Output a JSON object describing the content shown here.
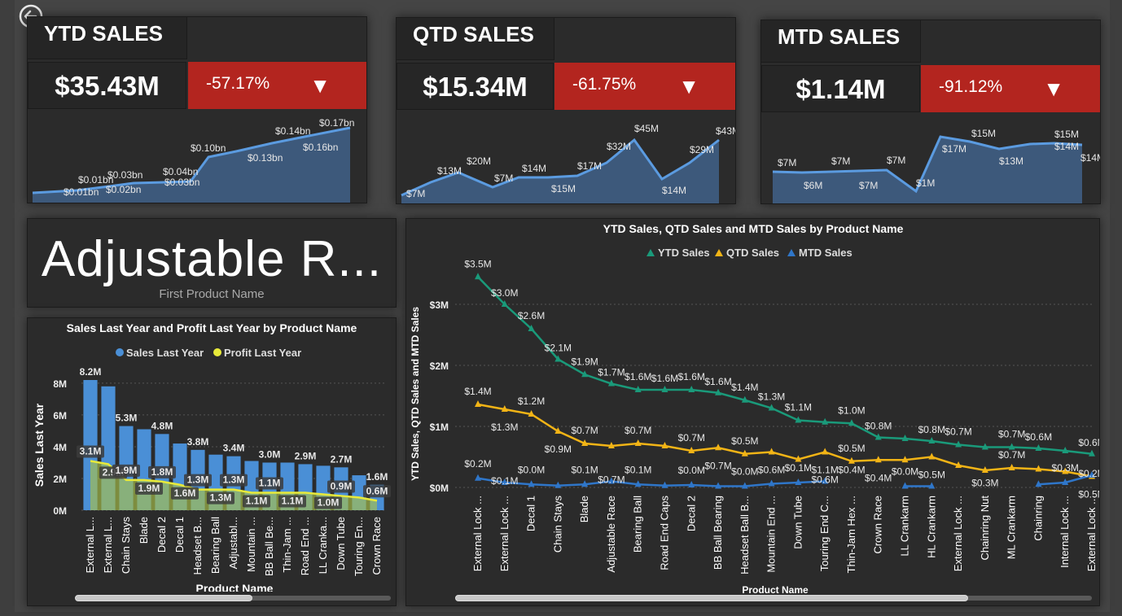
{
  "kpis": [
    {
      "title": "YTD SALES",
      "value": "$35.43M",
      "delta": "-57.17%",
      "arrow": "▼",
      "labels": [
        {
          "t": "$0.01bn",
          "x": 44,
          "y": 103
        },
        {
          "t": "$0.01bn",
          "x": 62,
          "y": 88
        },
        {
          "t": "$0.02bn",
          "x": 96,
          "y": 100
        },
        {
          "t": "$0.03bn",
          "x": 98,
          "y": 82
        },
        {
          "t": "$0.03bn",
          "x": 168,
          "y": 91
        },
        {
          "t": "$0.04bn",
          "x": 166,
          "y": 78
        },
        {
          "t": "$0.10bn",
          "x": 200,
          "y": 49
        },
        {
          "t": "$0.13bn",
          "x": 270,
          "y": 61
        },
        {
          "t": "$0.14bn",
          "x": 304,
          "y": 28
        },
        {
          "t": "$0.16bn",
          "x": 338,
          "y": 48
        },
        {
          "t": "$0.17bn",
          "x": 358,
          "y": 18
        }
      ]
    },
    {
      "title": "QTD SALES",
      "value": "$15.34M",
      "delta": "-61.75%",
      "arrow": "▼",
      "labels": [
        {
          "t": "$7M",
          "x": 12,
          "y": 104
        },
        {
          "t": "$13M",
          "x": 50,
          "y": 76
        },
        {
          "t": "$20M",
          "x": 86,
          "y": 64
        },
        {
          "t": "$7M",
          "x": 120,
          "y": 85
        },
        {
          "t": "$14M",
          "x": 154,
          "y": 73
        },
        {
          "t": "$15M",
          "x": 190,
          "y": 98
        },
        {
          "t": "$17M",
          "x": 222,
          "y": 70
        },
        {
          "t": "$32M",
          "x": 258,
          "y": 46
        },
        {
          "t": "$45M",
          "x": 292,
          "y": 24
        },
        {
          "t": "$14M",
          "x": 326,
          "y": 100
        },
        {
          "t": "$29M",
          "x": 360,
          "y": 50
        },
        {
          "t": "$43M",
          "x": 392,
          "y": 27
        }
      ]
    },
    {
      "title": "MTD SALES",
      "value": "$1.14M",
      "delta": "-91.12%",
      "arrow": "▼",
      "labels": [
        {
          "t": "$7M",
          "x": 20,
          "y": 63
        },
        {
          "t": "$6M",
          "x": 52,
          "y": 91
        },
        {
          "t": "$7M",
          "x": 86,
          "y": 61
        },
        {
          "t": "$7M",
          "x": 120,
          "y": 91
        },
        {
          "t": "$7M",
          "x": 154,
          "y": 60
        },
        {
          "t": "$1M",
          "x": 190,
          "y": 88
        },
        {
          "t": "$17M",
          "x": 222,
          "y": 46
        },
        {
          "t": "$15M",
          "x": 258,
          "y": 27
        },
        {
          "t": "$13M",
          "x": 292,
          "y": 61
        },
        {
          "t": "$15M",
          "x": 360,
          "y": 28
        },
        {
          "t": "$14M",
          "x": 360,
          "y": 43
        },
        {
          "t": "$14M",
          "x": 392,
          "y": 57
        }
      ]
    }
  ],
  "product_card": {
    "name": "Adjustable R...",
    "sub": "First Product Name"
  },
  "chart_data": [
    {
      "type": "bar",
      "title": "Sales Last Year and Profit Last Year by Product Name",
      "xlabel": "Product Name",
      "ylabel": "Sales Last Year",
      "ylim": [
        0,
        8200000
      ],
      "yticks": [
        "0M",
        "2M",
        "4M",
        "6M",
        "8M"
      ],
      "legend": [
        "Sales Last Year",
        "Profit Last Year"
      ],
      "colors": {
        "sales": "#4a8fd6",
        "profit": "#e8ea3a"
      },
      "categories": [
        "External L...",
        "External L...",
        "Chain Stays",
        "Blade",
        "Decal 2",
        "Decal 1",
        "Headset B...",
        "Bearing Ball",
        "Adjustabl...",
        "Mountain ...",
        "BB Ball Be...",
        "Thin-Jam ...",
        "Road End ...",
        "LL Cranka...",
        "Down Tube",
        "Touring En...",
        "Crown Race"
      ],
      "series": [
        {
          "name": "Sales Last Year",
          "values": [
            8.2,
            7.8,
            5.3,
            5.1,
            4.8,
            4.2,
            3.8,
            3.5,
            3.4,
            3.1,
            3.0,
            3.0,
            2.9,
            2.8,
            2.7,
            2.2,
            1.6
          ],
          "labels": [
            "8.2M",
            "",
            "5.3M",
            "",
            "4.8M",
            "",
            "3.8M",
            "",
            "3.4M",
            "",
            "3.0M",
            "",
            "2.9M",
            "",
            "2.7M",
            "",
            "1.6M"
          ]
        },
        {
          "name": "Profit Last Year",
          "values": [
            3.1,
            2.9,
            1.9,
            1.9,
            1.8,
            1.6,
            1.3,
            1.3,
            1.3,
            1.1,
            1.1,
            1.1,
            1.1,
            1.0,
            0.9,
            0.8,
            0.6
          ],
          "labels": [
            "3.1M",
            "2.9M",
            "1.9M",
            "1.9M",
            "1.8M",
            "1.6M",
            "1.3M",
            "1.3M",
            "1.3M",
            "1.1M",
            "1.1M",
            "1.1M",
            "",
            "1.0M",
            "0.9M",
            "",
            "0.6M"
          ]
        }
      ]
    },
    {
      "type": "line",
      "title": "YTD Sales, QTD Sales and MTD Sales by Product Name",
      "xlabel": "Product Name",
      "ylabel": "YTD Sales, QTD Sales and MTD Sales",
      "ylim": [
        0,
        3.5
      ],
      "yticks": [
        "$0M",
        "$1M",
        "$2M",
        "$3M"
      ],
      "legend": [
        "YTD Sales",
        "QTD Sales",
        "MTD Sales"
      ],
      "colors": {
        "ytd": "#1a9a7a",
        "qtd": "#f2b416",
        "mtd": "#2f76c9"
      },
      "categories": [
        "External Lock ...",
        "External Lock ...",
        "Decal 1",
        "Chain Stays",
        "Blade",
        "Adjustable Race",
        "Bearing Ball",
        "Road End Caps",
        "Decal 2",
        "BB Ball Bearing",
        "Headset Ball B...",
        "Mountain End ...",
        "Down Tube",
        "Touring End C...",
        "Thin-Jam Hex ...",
        "Crown Race",
        "LL Crankarm",
        "HL Crankarm",
        "External Lock ...",
        "Chainring Nut",
        "ML Crankarm",
        "Chainring",
        "Internal Lock ...",
        "External Lock ..."
      ],
      "series": [
        {
          "name": "YTD Sales",
          "values": [
            3.45,
            3.0,
            2.6,
            2.1,
            1.85,
            1.7,
            1.6,
            1.6,
            1.6,
            1.55,
            1.43,
            1.3,
            1.1,
            1.07,
            1.05,
            0.82,
            0.8,
            0.76,
            0.7,
            0.66,
            0.66,
            0.64,
            0.6,
            0.55
          ],
          "labels": [
            "$3.5M",
            "$3.0M",
            "$2.6M",
            "$2.1M",
            "$1.9M",
            "$1.7M",
            "$1.6M",
            "$1.6M",
            "$1.6M",
            "$1.6M",
            "$1.4M",
            "$1.3M",
            "$1.1M",
            "",
            "$1.0M",
            "$0.8M",
            "",
            "$0.8M",
            "$0.7M",
            "",
            "$0.7M",
            "$0.6M",
            "",
            "$0.6M"
          ]
        },
        {
          "name": "QTD Sales",
          "values": [
            1.36,
            1.28,
            1.2,
            0.92,
            0.72,
            0.68,
            0.72,
            0.68,
            0.6,
            0.65,
            0.55,
            0.58,
            0.46,
            0.58,
            0.43,
            0.45,
            0.45,
            0.5,
            0.36,
            0.28,
            0.32,
            0.3,
            0.26,
            0.18
          ],
          "labels": [
            "$1.4M",
            "$1.3M",
            "$1.2M",
            "$0.9M",
            "$0.7M",
            "",
            "$0.7M",
            "",
            "$0.7M",
            "$0.7M",
            "$0.5M",
            "$0.6M",
            "",
            "$1.1M",
            "$0.5M",
            "$0.4M",
            "",
            "$0.5M",
            "",
            "",
            "$0.7M",
            "",
            "",
            "$0.5M"
          ]
        },
        {
          "name": "MTD Sales",
          "values": [
            0.15,
            0.08,
            0.05,
            0.03,
            0.05,
            0.1,
            0.05,
            0.03,
            0.04,
            0.02,
            0.02,
            0.06,
            0.08,
            0.1,
            null,
            null,
            0.02,
            0.02,
            null,
            null,
            null,
            0.05,
            0.08,
            0.2
          ],
          "labels": [
            "$0.2M",
            "$0.1M",
            "$0.0M",
            "",
            "$0.1M",
            "$0.7M",
            "$0.1M",
            "",
            "$0.0M",
            "",
            "$0.0M",
            "",
            "$0.1M",
            "$0.6M",
            "$0.4M",
            "",
            "$0.0M",
            "",
            "",
            "$0.3M",
            "",
            "",
            "$0.3M",
            "$0.2M"
          ]
        }
      ]
    }
  ]
}
